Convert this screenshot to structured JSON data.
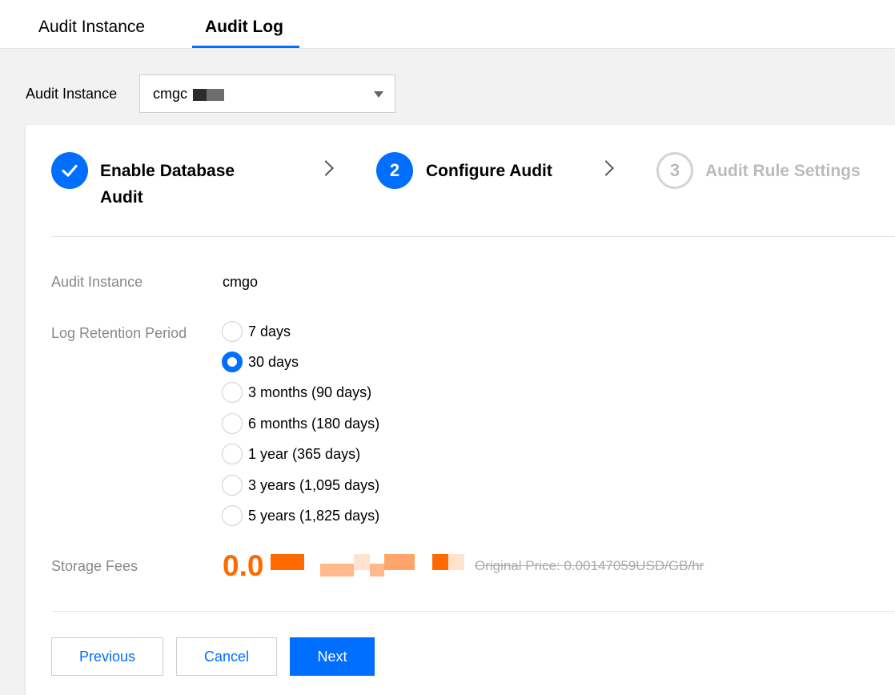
{
  "tabs": [
    {
      "label": "Audit Instance"
    },
    {
      "label": "Audit Log"
    }
  ],
  "instance_selector": {
    "label": "Audit Instance",
    "value": "cmgc"
  },
  "steps": [
    {
      "number": "",
      "title": "Enable Database Audit",
      "status": "done"
    },
    {
      "number": "2",
      "title": "Configure Audit",
      "status": "active"
    },
    {
      "number": "3",
      "title": "Audit Rule Settings",
      "status": "pending"
    }
  ],
  "form": {
    "instance_label": "Audit Instance",
    "instance_value": "cmgo",
    "retention_label": "Log Retention Period",
    "retention_options": [
      {
        "label": "7 days"
      },
      {
        "label": "30 days"
      },
      {
        "label": "3 months (90 days)"
      },
      {
        "label": "6 months (180 days)"
      },
      {
        "label": "1 year (365 days)"
      },
      {
        "label": "3 years (1,095 days)"
      },
      {
        "label": "5 years (1,825 days)"
      }
    ],
    "selected_retention": "30 days",
    "storage_label": "Storage Fees",
    "storage_price": "0.0",
    "original_price": "Original Price: 0.00147059USD/GB/hr"
  },
  "buttons": {
    "previous": "Previous",
    "cancel": "Cancel",
    "next": "Next"
  },
  "colors": {
    "accent": "#006eff",
    "price": "#ff6a00"
  }
}
